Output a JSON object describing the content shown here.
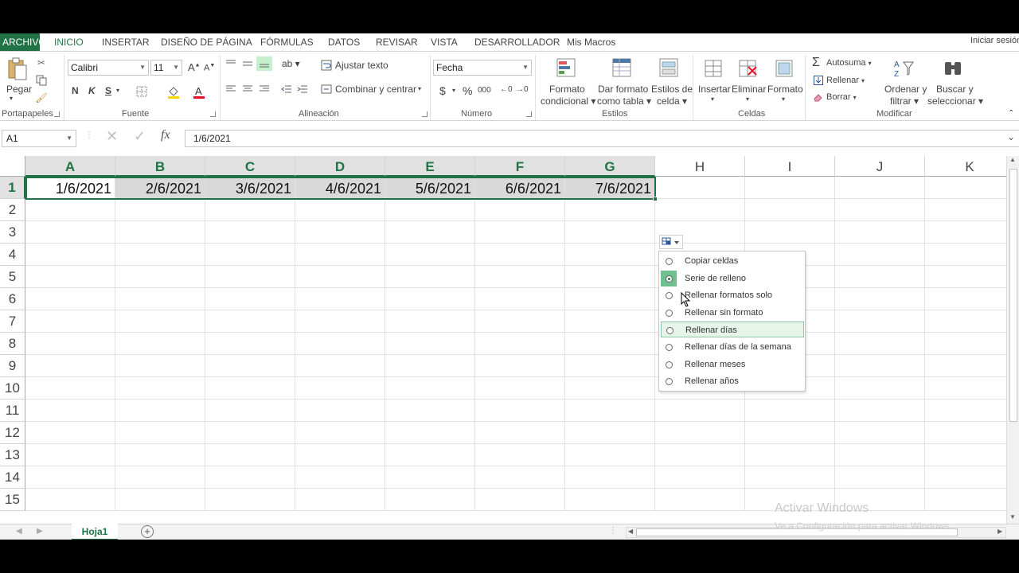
{
  "tabs": {
    "file": "ARCHIVO",
    "home": "INICIO",
    "insert": "INSERTAR",
    "page_layout": "DISEÑO DE PÁGINA",
    "formulas": "FÓRMULAS",
    "data": "DATOS",
    "review": "REVISAR",
    "view": "VISTA",
    "developer": "DESARROLLADOR",
    "macros": "Mis Macros",
    "signin": "Iniciar sesión"
  },
  "ribbon": {
    "clipboard": {
      "paste": "Pegar",
      "group": "Portapapeles"
    },
    "font": {
      "name": "Calibri",
      "size": "11",
      "bold": "N",
      "italic": "K",
      "underline": "S",
      "group": "Fuente"
    },
    "alignment": {
      "wrap": "Ajustar texto",
      "merge": "Combinar y centrar",
      "group": "Alineación"
    },
    "number": {
      "format": "Fecha",
      "currency": "$",
      "percent": "%",
      "thousands": "000",
      "group": "Número"
    },
    "styles": {
      "conditional_1": "Formato",
      "conditional_2": "condicional",
      "table_1": "Dar formato",
      "table_2": "como tabla",
      "cell_1": "Estilos de",
      "cell_2": "celda",
      "group": "Estilos"
    },
    "cells": {
      "insert": "Insertar",
      "delete": "Eliminar",
      "format": "Formato",
      "group": "Celdas"
    },
    "editing": {
      "autosum": "Autosuma",
      "fill": "Rellenar",
      "clear": "Borrar",
      "sort_1": "Ordenar y",
      "sort_2": "filtrar",
      "find_1": "Buscar y",
      "find_2": "seleccionar",
      "group": "Modificar"
    }
  },
  "formula_bar": {
    "name_box": "A1",
    "fx": "fx",
    "content": "1/6/2021"
  },
  "grid": {
    "columns": [
      "A",
      "B",
      "C",
      "D",
      "E",
      "F",
      "G",
      "H",
      "I",
      "J",
      "K"
    ],
    "rows": [
      "1",
      "2",
      "3",
      "4",
      "5",
      "6",
      "7",
      "8",
      "9",
      "10",
      "11",
      "12",
      "13",
      "14",
      "15"
    ],
    "row1_values": [
      "1/6/2021",
      "2/6/2021",
      "3/6/2021",
      "4/6/2021",
      "5/6/2021",
      "6/6/2021",
      "7/6/2021"
    ]
  },
  "autofill_menu": {
    "items": [
      {
        "label": "Copiar celdas",
        "checked": false
      },
      {
        "label": "Serie de relleno",
        "checked": true
      },
      {
        "label": "Rellenar formatos solo",
        "checked": false
      },
      {
        "label": "Rellenar sin formato",
        "checked": false
      },
      {
        "label": "Rellenar días",
        "checked": false,
        "hover": true
      },
      {
        "label": "Rellenar días de la semana",
        "checked": false
      },
      {
        "label": "Rellenar meses",
        "checked": false
      },
      {
        "label": "Rellenar años",
        "checked": false
      }
    ]
  },
  "sheets": {
    "active": "Hoja1"
  },
  "watermark": {
    "line1": "Activar Windows",
    "line2": "Ve a Configuración para activar Windows."
  },
  "colors": {
    "accent": "#217346",
    "selection": "#d9d9d9"
  }
}
